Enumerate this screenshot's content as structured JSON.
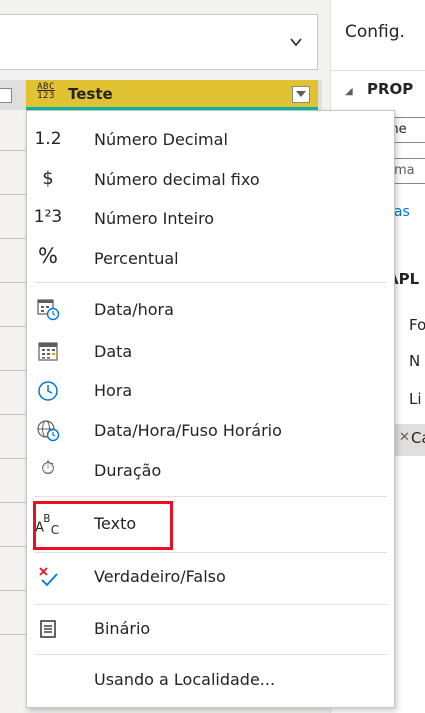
{
  "left_pane": {
    "column_header": {
      "type_icon_top": "ABC",
      "type_icon_bottom": "123",
      "title": "Teste"
    }
  },
  "right_pane": {
    "title": "Config.",
    "properties_heading": "PROP",
    "name_field_value": "me",
    "second_field_value": "ema",
    "link_fragment": "das",
    "applied_steps_heading": "APL",
    "steps": [
      "Fo",
      "N",
      "Li",
      "Ca"
    ]
  },
  "menu": {
    "items": [
      {
        "icon": "1.2",
        "icon_name": "decimal-number-icon",
        "label": "Número Decimal"
      },
      {
        "icon": "$",
        "icon_name": "currency-icon",
        "label": "Número decimal fixo"
      },
      {
        "icon": "1²3",
        "icon_name": "whole-number-icon",
        "label": "Número Inteiro"
      },
      {
        "icon": "%",
        "icon_name": "percent-icon",
        "label": "Percentual"
      },
      {
        "icon": "",
        "icon_name": "datetime-icon",
        "label": "Data/hora"
      },
      {
        "icon": "",
        "icon_name": "date-icon",
        "label": "Data"
      },
      {
        "icon": "",
        "icon_name": "clock-icon",
        "label": "Hora"
      },
      {
        "icon": "",
        "icon_name": "datetime-timezone-icon",
        "label": "Data/Hora/Fuso Horário"
      },
      {
        "icon": "⏱",
        "icon_name": "stopwatch-icon",
        "label": "Duração"
      },
      {
        "icon": "",
        "icon_name": "text-type-icon",
        "label": "Texto"
      },
      {
        "icon": "",
        "icon_name": "true-false-icon",
        "label": "Verdadeiro/Falso"
      },
      {
        "icon": "",
        "icon_name": "binary-icon",
        "label": "Binário"
      },
      {
        "icon": "",
        "icon_name": "",
        "label": "Usando a Localidade..."
      }
    ],
    "selected_label": "Texto",
    "highlight_color": "#e81123"
  },
  "colors": {
    "column_header_bg": "#e1c233",
    "column_header_underline": "#0bb3a5",
    "link": "#0078d4"
  }
}
